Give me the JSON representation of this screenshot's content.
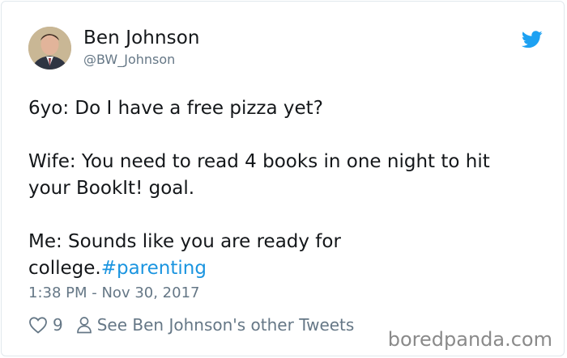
{
  "tweet": {
    "author_name": "Ben Johnson",
    "author_handle": "@BW_Johnson",
    "lines": {
      "line1": "6yo: Do I have a free pizza yet?",
      "line2": "Wife: You need to read 4 books in one night to hit your BookIt! goal.",
      "line3_prefix": "Me: Sounds like you are ready for college.",
      "hashtag": "#parenting"
    },
    "timestamp": "1:38 PM - Nov 30, 2017",
    "like_count": "9",
    "other_tweets_label": "See Ben Johnson's other Tweets"
  },
  "watermark": "boredpanda.com",
  "colors": {
    "twitter_blue": "#1b95e0",
    "text": "#14171a",
    "muted": "#657786"
  },
  "icons": {
    "brand": "twitter-bird-icon",
    "like": "heart-icon",
    "profile": "person-icon"
  }
}
